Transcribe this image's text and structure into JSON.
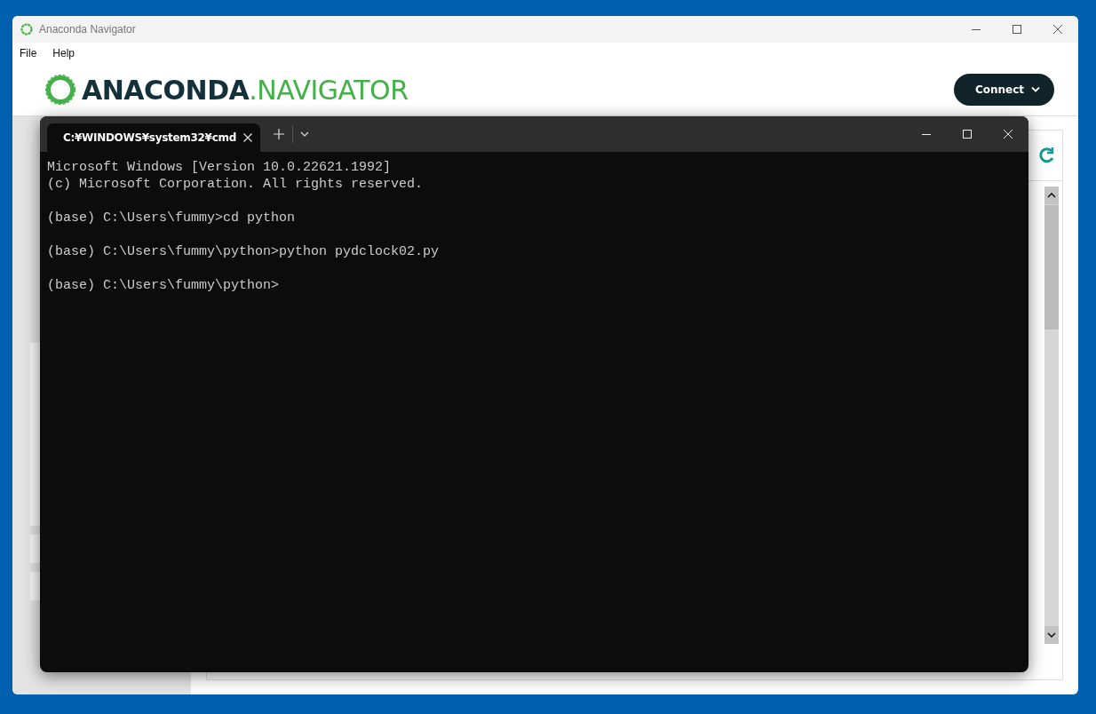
{
  "navigator": {
    "title": "Anaconda Navigator",
    "menu": [
      {
        "label": "File"
      },
      {
        "label": "Help"
      }
    ],
    "logo": {
      "brand": "ANACONDA",
      "product": ".NAVIGATOR"
    },
    "connect_button": "Connect"
  },
  "terminal": {
    "tabs": [
      {
        "title": "C:¥WINDOWS¥system32¥cmd",
        "selected": true
      }
    ],
    "output": [
      [
        "Microsoft Windows [Version 10.0.22621.1992]",
        "(c) Microsoft Corporation. All rights reserved."
      ],
      [
        "(base) C:\\Users\\fummy>cd python"
      ],
      [
        "(base) C:\\Users\\fummy\\python>python pydclock02.py"
      ],
      [
        "(base) C:\\Users\\fummy\\python>"
      ]
    ]
  }
}
